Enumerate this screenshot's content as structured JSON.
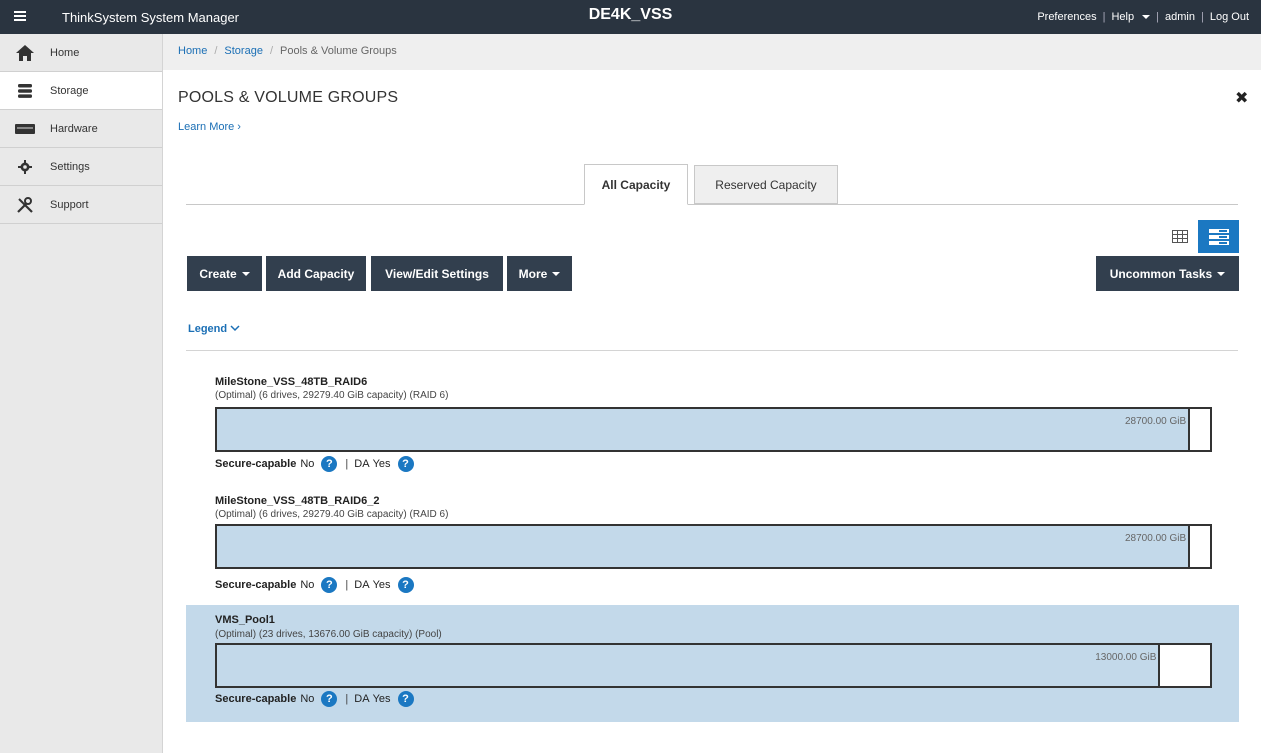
{
  "topbar": {
    "app_title": "ThinkSystem System Manager",
    "system_name": "DE4K_VSS",
    "preferences": "Preferences",
    "help": "Help",
    "user": "admin",
    "logout": "Log Out"
  },
  "sidebar": {
    "items": [
      {
        "label": "Home",
        "icon": "home-icon"
      },
      {
        "label": "Storage",
        "icon": "storage-icon"
      },
      {
        "label": "Hardware",
        "icon": "hardware-icon"
      },
      {
        "label": "Settings",
        "icon": "gear-icon"
      },
      {
        "label": "Support",
        "icon": "tools-icon"
      }
    ],
    "active": "Storage"
  },
  "breadcrumb": [
    "Home",
    "Storage",
    "Pools & Volume Groups"
  ],
  "page": {
    "title": "POOLS & VOLUME GROUPS",
    "learn_more": "Learn More ›",
    "close": "✖"
  },
  "tabs": [
    "All Capacity",
    "Reserved Capacity"
  ],
  "toolbar": {
    "create": "Create",
    "add_capacity": "Add Capacity",
    "view_edit": "View/Edit Settings",
    "more": "More",
    "uncommon": "Uncommon Tasks"
  },
  "legend": "Legend",
  "pools": [
    {
      "name": "MileStone_VSS_48TB_RAID6",
      "desc": "(Optimal) (6 drives, 29279.40 GiB capacity) (RAID 6)",
      "used": "28700.00 GiB",
      "fill_fraction": 0.98,
      "secure_label": "Secure-capable",
      "secure_value": "No",
      "da_label": "DA",
      "da_value": "Yes"
    },
    {
      "name": "MileStone_VSS_48TB_RAID6_2",
      "desc": "(Optimal) (6 drives, 29279.40 GiB capacity) (RAID 6)",
      "used": "28700.00 GiB",
      "fill_fraction": 0.98,
      "secure_label": "Secure-capable",
      "secure_value": "No",
      "da_label": "DA",
      "da_value": "Yes"
    },
    {
      "name": "VMS_Pool1",
      "desc": "(Optimal) (23 drives, 13676.00 GiB capacity) (Pool)",
      "used": "13000.00 GiB",
      "fill_fraction": 0.95,
      "secure_label": "Secure-capable",
      "secure_value": "No",
      "da_label": "DA",
      "da_value": "Yes"
    }
  ]
}
